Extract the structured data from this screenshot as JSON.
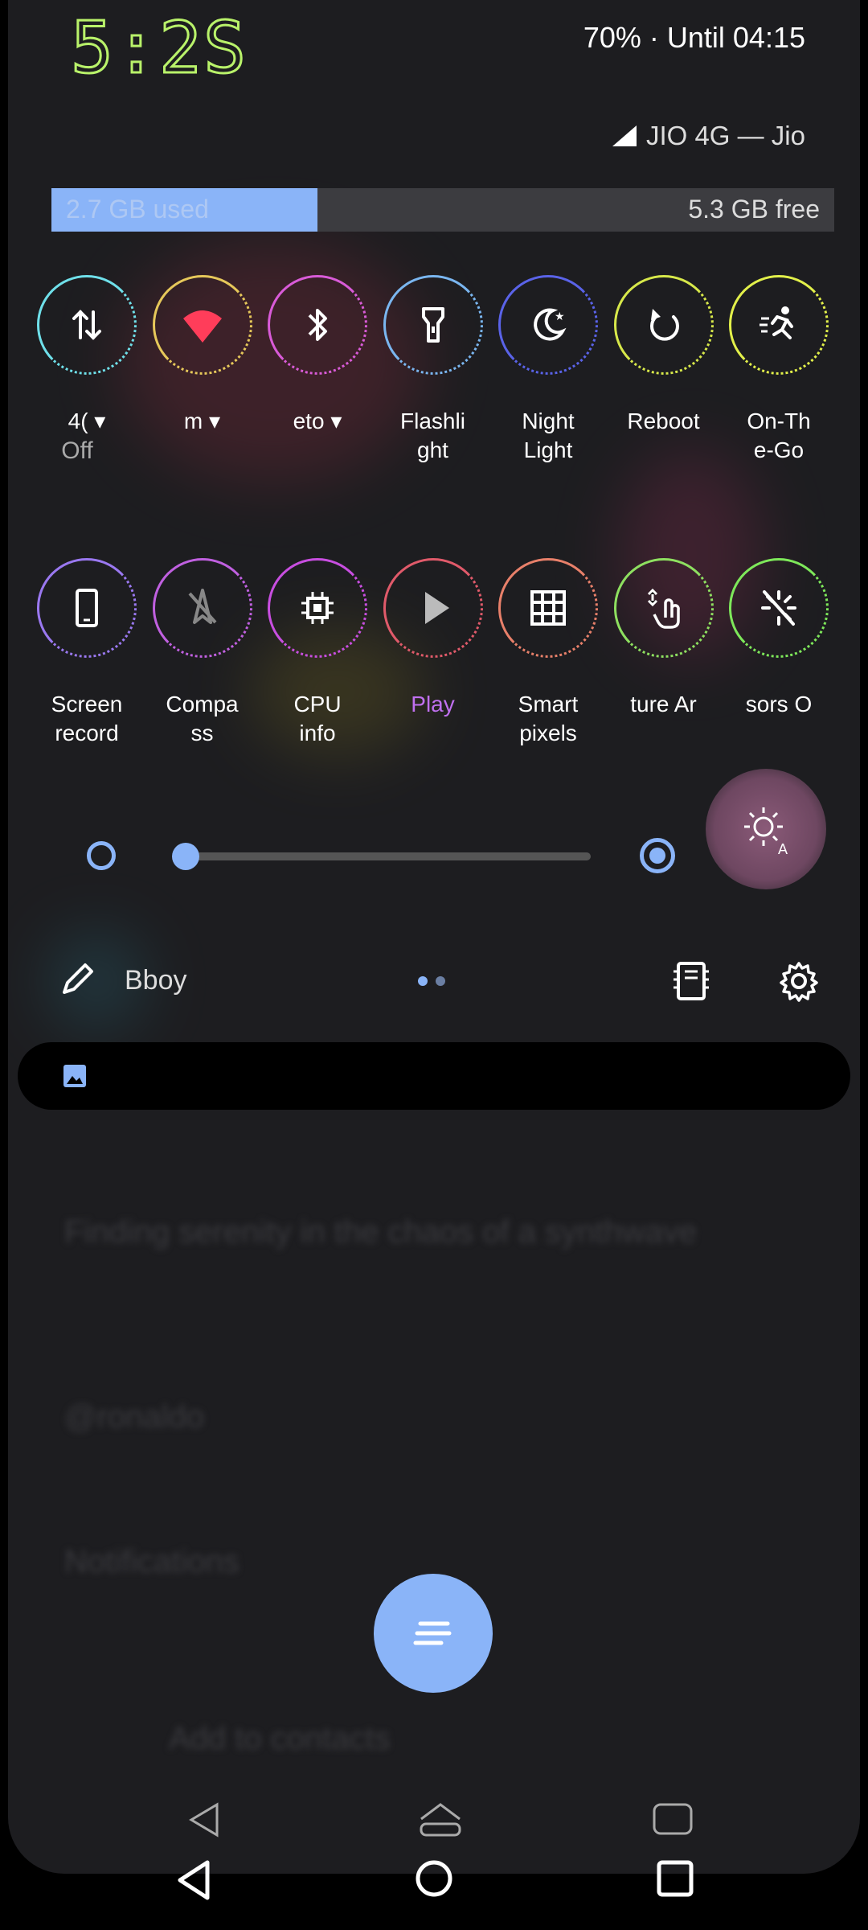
{
  "status": {
    "clock": "5:2S",
    "battery": "70% · Until 04:15",
    "carrier": "JIO 4G — Jio"
  },
  "storage": {
    "used_label": "2.7 GB used",
    "free_label": "5.3 GB free",
    "used_fraction": 0.34,
    "color": "#8ab4f8"
  },
  "tiles_row1": [
    {
      "label": "4(",
      "sub": "Off",
      "icon": "data-transfer-icon",
      "ring": "#6fe0ea",
      "dropdown": true
    },
    {
      "label": "m",
      "sub": "",
      "icon": "wifi-icon",
      "ring": "#e6c85a",
      "dropdown": true
    },
    {
      "label": "eto",
      "sub": "",
      "icon": "bluetooth-icon",
      "ring": "#d95bd8",
      "dropdown": true
    },
    {
      "label": "Flashli\nght",
      "sub": "",
      "icon": "flashlight-icon",
      "ring": "#7ab6f0"
    },
    {
      "label": "Night\nLight",
      "sub": "",
      "icon": "night-light-icon",
      "ring": "#5a63e8"
    },
    {
      "label": "Reboot",
      "sub": "",
      "icon": "reboot-icon",
      "ring": "#d7e84a"
    },
    {
      "label": "On-Th\ne-Go",
      "sub": "",
      "icon": "running-icon",
      "ring": "#e2f04a"
    }
  ],
  "tiles_row2": [
    {
      "label": "Screen\nrecord",
      "icon": "phone-icon",
      "ring": "#9a78f0"
    },
    {
      "label": "Compa\nss",
      "icon": "compass-off-icon",
      "ring": "#c060e0"
    },
    {
      "label": "CPU\ninfo",
      "icon": "cpu-icon",
      "ring": "#c84ee0"
    },
    {
      "label": "Play",
      "icon": "play-icon",
      "ring": "#e05a6a",
      "label_color": "#c070f0"
    },
    {
      "label": "Smart\npixels",
      "icon": "grid-icon",
      "ring": "#e8806a"
    },
    {
      "label": "ture Ar",
      "icon": "touch-icon",
      "ring": "#8ee060"
    },
    {
      "label": "sors O",
      "icon": "sensors-off-icon",
      "ring": "#7ee85a"
    }
  ],
  "brightness": {
    "level": 0.0
  },
  "footer": {
    "user": "Bboy"
  },
  "colors": {
    "accent": "#8ab4f8",
    "panel": "#1d1d20"
  }
}
